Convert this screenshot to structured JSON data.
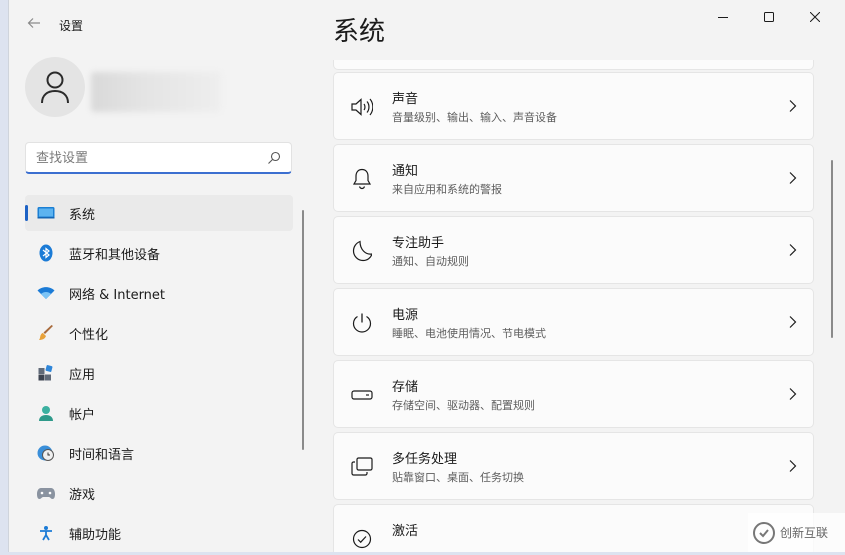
{
  "app": {
    "back_icon": "back-arrow-icon",
    "title": "设置"
  },
  "window_controls": {
    "minimize": "minimize-icon",
    "maximize": "maximize-icon",
    "close": "close-icon"
  },
  "user": {
    "avatar_icon": "person-icon"
  },
  "search": {
    "placeholder": "查找设置",
    "value": ""
  },
  "nav": [
    {
      "label": "系统",
      "icon": "display-icon",
      "active": true
    },
    {
      "label": "蓝牙和其他设备",
      "icon": "bluetooth-icon"
    },
    {
      "label": "网络 & Internet",
      "icon": "wifi-icon"
    },
    {
      "label": "个性化",
      "icon": "brush-icon"
    },
    {
      "label": "应用",
      "icon": "apps-icon"
    },
    {
      "label": "帐户",
      "icon": "account-icon"
    },
    {
      "label": "时间和语言",
      "icon": "clock-globe-icon"
    },
    {
      "label": "游戏",
      "icon": "gamepad-icon"
    },
    {
      "label": "辅助功能",
      "icon": "accessibility-icon"
    }
  ],
  "page": {
    "title": "系统"
  },
  "cards": [
    {
      "title": "声音",
      "subtitle": "音量级别、输出、输入、声音设备",
      "icon": "speaker-icon"
    },
    {
      "title": "通知",
      "subtitle": "来自应用和系统的警报",
      "icon": "bell-icon"
    },
    {
      "title": "专注助手",
      "subtitle": "通知、自动规则",
      "icon": "moon-icon"
    },
    {
      "title": "电源",
      "subtitle": "睡眠、电池使用情况、节电模式",
      "icon": "power-icon"
    },
    {
      "title": "存储",
      "subtitle": "存储空间、驱动器、配置规则",
      "icon": "storage-icon"
    },
    {
      "title": "多任务处理",
      "subtitle": "贴靠窗口、桌面、任务切换",
      "icon": "multitask-icon"
    },
    {
      "title": "激活",
      "subtitle": "",
      "icon": "check-circle-icon"
    }
  ],
  "watermark": {
    "text": "创新互联"
  },
  "colors": {
    "accent": "#1d62c5",
    "background": "#f3f3f3",
    "card": "#fbfbfb"
  }
}
